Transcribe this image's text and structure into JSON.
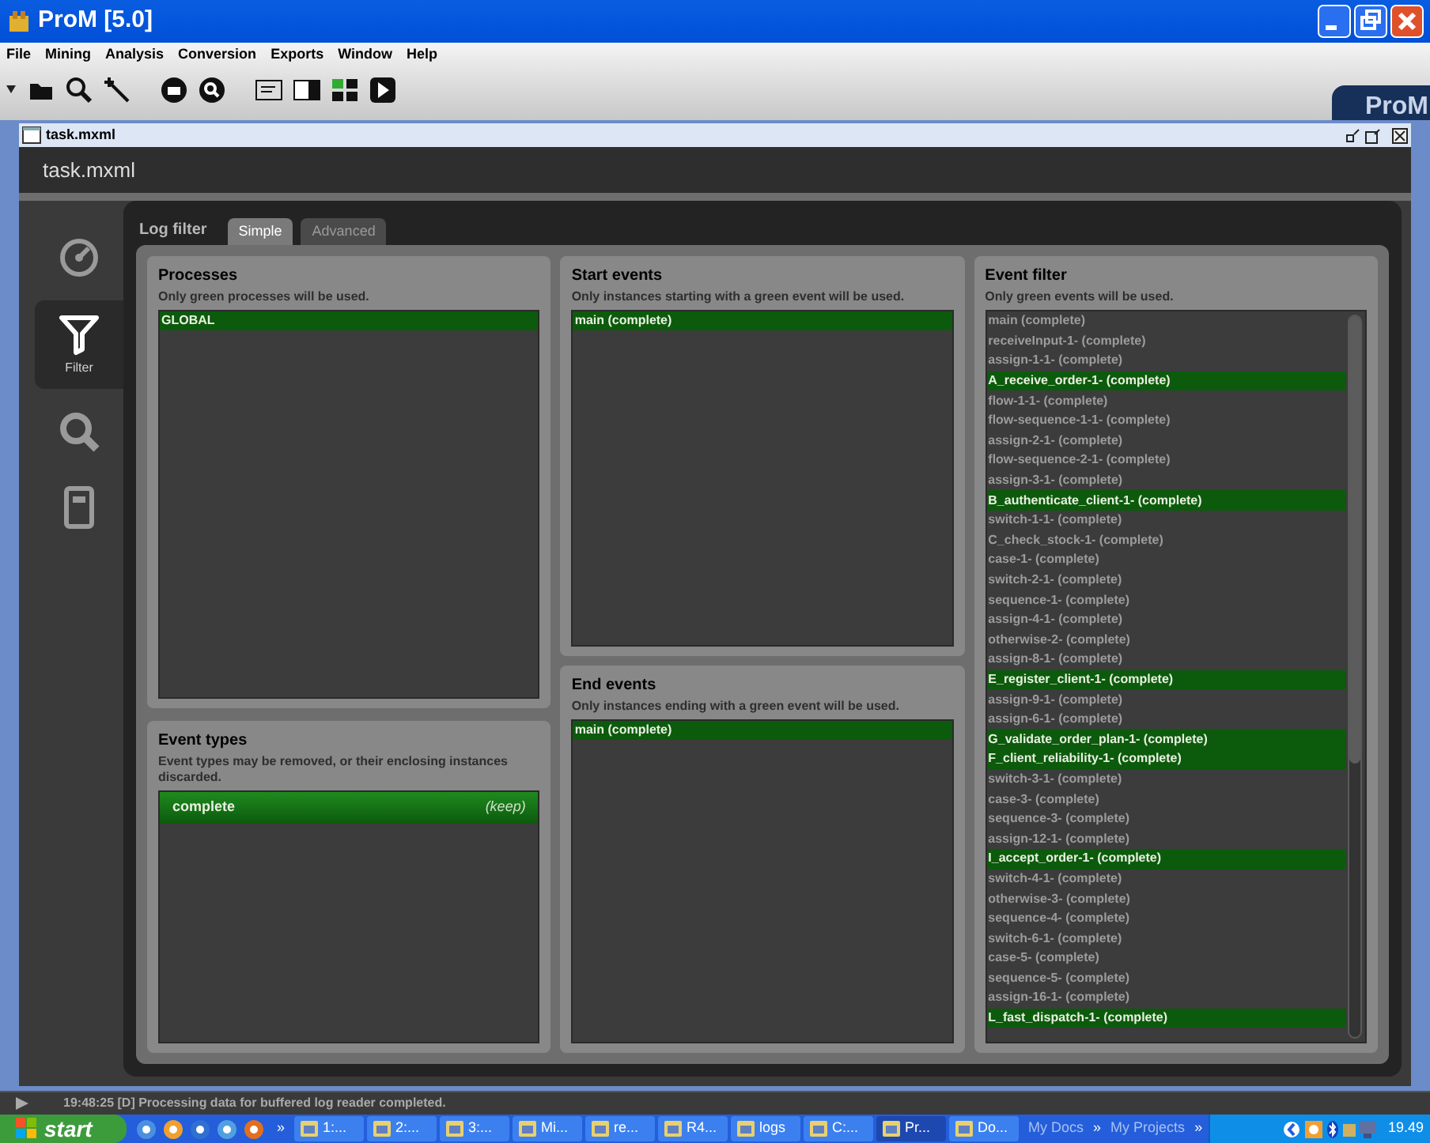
{
  "window": {
    "title": "ProM [5.0]"
  },
  "menu": [
    "File",
    "Mining",
    "Analysis",
    "Conversion",
    "Exports",
    "Window",
    "Help"
  ],
  "brand": "ProM",
  "internal_frame": {
    "title": "task.mxml"
  },
  "header": {
    "title": "task.mxml"
  },
  "sidebar": {
    "items": [
      {
        "kind": "gauge",
        "selected": false
      },
      {
        "kind": "filter",
        "label": "Filter",
        "selected": true
      },
      {
        "kind": "search",
        "selected": false
      },
      {
        "kind": "notebook",
        "selected": false
      }
    ]
  },
  "log_filter": {
    "title": "Log filter",
    "tabs": [
      {
        "label": "Simple",
        "selected": true
      },
      {
        "label": "Advanced",
        "selected": false
      }
    ]
  },
  "processes": {
    "title": "Processes",
    "hint": "Only green processes will be used.",
    "items": [
      {
        "label": "GLOBAL",
        "selected": true
      }
    ]
  },
  "event_types": {
    "title": "Event types",
    "hint": "Event types may be removed, or their enclosing instances discarded.",
    "items": [
      {
        "label": "complete",
        "action": "(keep)",
        "selected": true
      }
    ]
  },
  "start_events": {
    "title": "Start events",
    "hint": "Only instances starting with a green event will be used.",
    "items": [
      {
        "label": "main (complete)",
        "selected": true
      }
    ]
  },
  "end_events": {
    "title": "End events",
    "hint": "Only instances ending with a green event will be used.",
    "items": [
      {
        "label": "main (complete)",
        "selected": true
      }
    ]
  },
  "event_filter": {
    "title": "Event filter",
    "hint": "Only green events will be used.",
    "items": [
      {
        "label": "main (complete)",
        "selected": false
      },
      {
        "label": "receiveInput-1- (complete)",
        "selected": false
      },
      {
        "label": "assign-1-1- (complete)",
        "selected": false
      },
      {
        "label": "A_receive_order-1- (complete)",
        "selected": true
      },
      {
        "label": "flow-1-1- (complete)",
        "selected": false
      },
      {
        "label": "flow-sequence-1-1- (complete)",
        "selected": false
      },
      {
        "label": "assign-2-1- (complete)",
        "selected": false
      },
      {
        "label": "flow-sequence-2-1- (complete)",
        "selected": false
      },
      {
        "label": "assign-3-1- (complete)",
        "selected": false
      },
      {
        "label": "B_authenticate_client-1- (complete)",
        "selected": true
      },
      {
        "label": "switch-1-1- (complete)",
        "selected": false
      },
      {
        "label": "C_check_stock-1- (complete)",
        "selected": false
      },
      {
        "label": "case-1- (complete)",
        "selected": false
      },
      {
        "label": "switch-2-1- (complete)",
        "selected": false
      },
      {
        "label": "sequence-1- (complete)",
        "selected": false
      },
      {
        "label": "assign-4-1- (complete)",
        "selected": false
      },
      {
        "label": "otherwise-2- (complete)",
        "selected": false
      },
      {
        "label": "assign-8-1- (complete)",
        "selected": false
      },
      {
        "label": "E_register_client-1- (complete)",
        "selected": true
      },
      {
        "label": "assign-9-1- (complete)",
        "selected": false
      },
      {
        "label": "assign-6-1- (complete)",
        "selected": false
      },
      {
        "label": "G_validate_order_plan-1- (complete)",
        "selected": true
      },
      {
        "label": "F_client_reliability-1- (complete)",
        "selected": true
      },
      {
        "label": "switch-3-1- (complete)",
        "selected": false
      },
      {
        "label": "case-3- (complete)",
        "selected": false
      },
      {
        "label": "sequence-3- (complete)",
        "selected": false
      },
      {
        "label": "assign-12-1- (complete)",
        "selected": false
      },
      {
        "label": "I_accept_order-1- (complete)",
        "selected": true
      },
      {
        "label": "switch-4-1- (complete)",
        "selected": false
      },
      {
        "label": "otherwise-3- (complete)",
        "selected": false
      },
      {
        "label": "sequence-4- (complete)",
        "selected": false
      },
      {
        "label": "switch-6-1- (complete)",
        "selected": false
      },
      {
        "label": "case-5- (complete)",
        "selected": false
      },
      {
        "label": "sequence-5- (complete)",
        "selected": false
      },
      {
        "label": "assign-16-1- (complete)",
        "selected": false
      },
      {
        "label": "L_fast_dispatch-1- (complete)",
        "selected": true
      }
    ]
  },
  "status_bar": {
    "text": "19:48:25 [D] Processing data for buffered log reader completed."
  },
  "taskbar": {
    "start": "start",
    "quick_launch_more": "»",
    "tasks": [
      {
        "label": "1:...",
        "active": false
      },
      {
        "label": "2:...",
        "active": false
      },
      {
        "label": "3:...",
        "active": false
      },
      {
        "label": "Mi...",
        "active": false
      },
      {
        "label": "re...",
        "active": false
      },
      {
        "label": "R4...",
        "active": false
      },
      {
        "label": "logs",
        "active": false
      },
      {
        "label": "C:...",
        "active": false
      },
      {
        "label": "Pr...",
        "active": true
      },
      {
        "label": "Do...",
        "active": false
      }
    ],
    "toolbars": [
      "My Docs",
      "»",
      "My Projects",
      "»"
    ],
    "clock": "19.49"
  }
}
